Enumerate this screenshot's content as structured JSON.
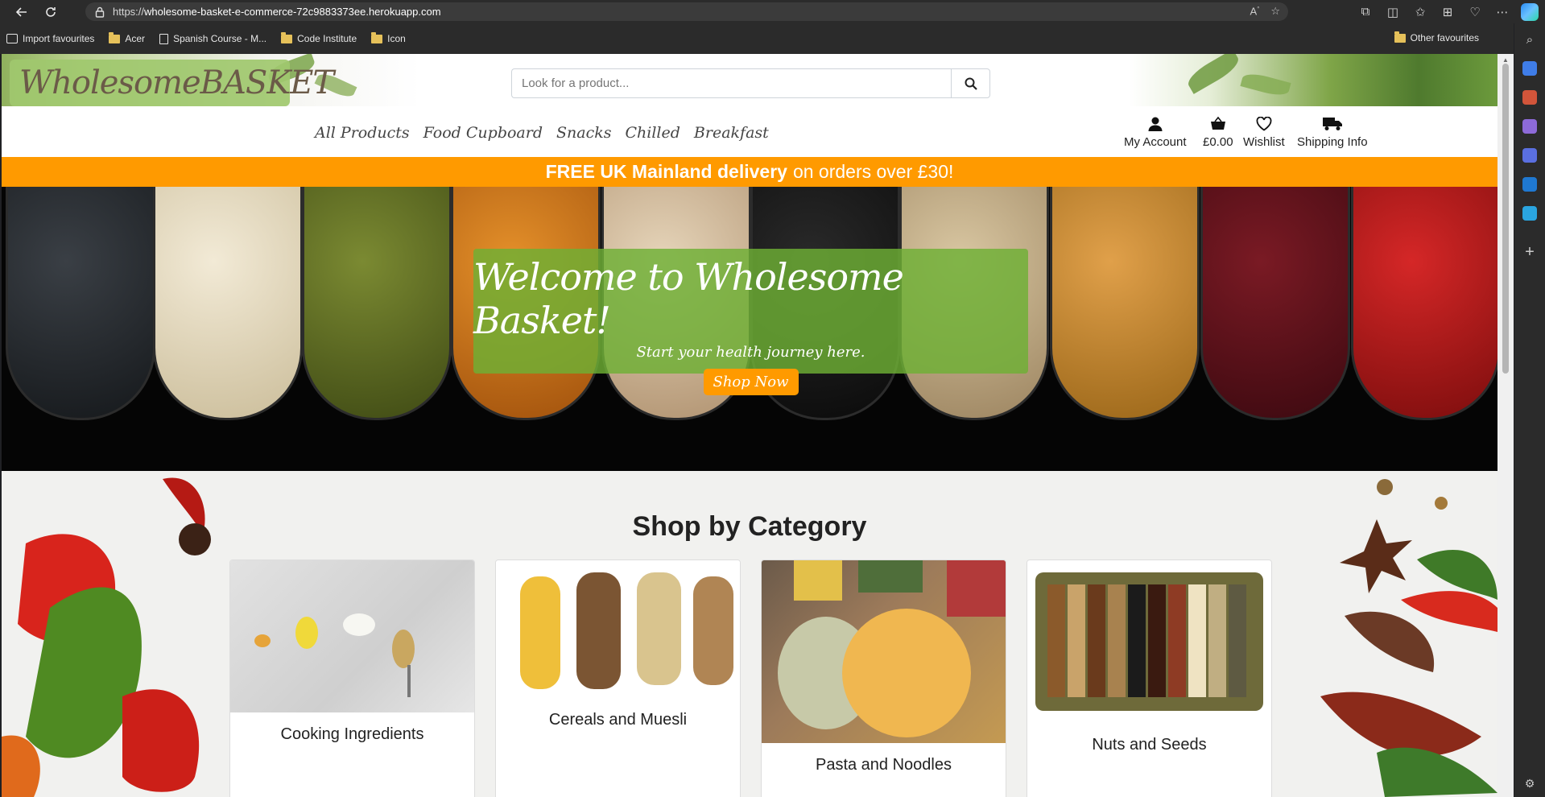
{
  "browser": {
    "url_prefix": "https://",
    "url_host": "wholesome-basket-e-commerce-72c9883373ee.herokuapp.com",
    "bookmarks": [
      {
        "label": "Import favourites",
        "kind": "import"
      },
      {
        "label": "Acer",
        "kind": "folder"
      },
      {
        "label": "Spanish Course - M...",
        "kind": "page"
      },
      {
        "label": "Code Institute",
        "kind": "folder"
      },
      {
        "label": "Icon",
        "kind": "folder"
      }
    ],
    "other_favourites": "Other favourites"
  },
  "site": {
    "logo_text": "WholesomeBASKET",
    "search_placeholder": "Look for a product...",
    "nav": [
      "All Products",
      "Food Cupboard",
      "Snacks",
      "Chilled",
      "Breakfast"
    ],
    "account": {
      "my_account": "My Account",
      "basket_total": "£0.00",
      "wishlist": "Wishlist",
      "shipping": "Shipping Info"
    },
    "delivery": {
      "bold": "FREE UK Mainland delivery",
      "rest": "on orders over £30!"
    },
    "hero": {
      "title": "Welcome to Wholesome Basket!",
      "subtitle": "Start your health journey here.",
      "cta": "Shop Now"
    },
    "category_heading": "Shop by Category",
    "categories": [
      {
        "label": "Cooking Ingredients"
      },
      {
        "label": "Cereals and Muesli"
      },
      {
        "label": "Pasta and Noodles"
      },
      {
        "label": "Nuts and Seeds"
      }
    ]
  },
  "colors": {
    "accent_orange": "#ff9a00",
    "hero_overlay_green": "#6eb034",
    "logo_green": "#a0c86e"
  }
}
